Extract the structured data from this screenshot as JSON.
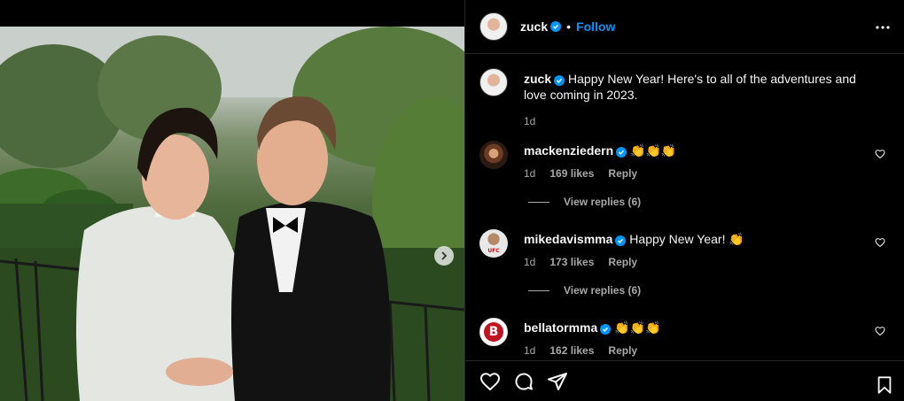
{
  "post": {
    "author": "zuck",
    "follow_label": "Follow",
    "separator": "•",
    "caption": "Happy New Year! Here's to all of the adventures and love coming in 2023.",
    "caption_time": "1d"
  },
  "comments": [
    {
      "user": "mackenziedern",
      "text": "👏👏👏",
      "time": "1d",
      "likes": "169 likes",
      "reply": "Reply",
      "view_replies": "View replies (6)"
    },
    {
      "user": "mikedavismma",
      "text": "Happy New Year! 👏",
      "time": "1d",
      "likes": "173 likes",
      "reply": "Reply",
      "view_replies": "View replies (6)"
    },
    {
      "user": "bellatormma",
      "text": "👏👏👏",
      "time": "1d",
      "likes": "162 likes",
      "reply": "Reply"
    }
  ],
  "avatar_text": {
    "ufc": "UFC",
    "bellator": "B"
  },
  "icons": {
    "more": "more-horizontal-icon",
    "verified": "verified-badge-icon",
    "heart": "heart-icon",
    "like": "heart-outline-icon",
    "comment": "comment-icon",
    "share": "share-icon",
    "save": "bookmark-icon",
    "next": "chevron-right-icon"
  },
  "colors": {
    "accent": "#0095f6",
    "background": "#000000",
    "muted": "#a8a8a8"
  }
}
